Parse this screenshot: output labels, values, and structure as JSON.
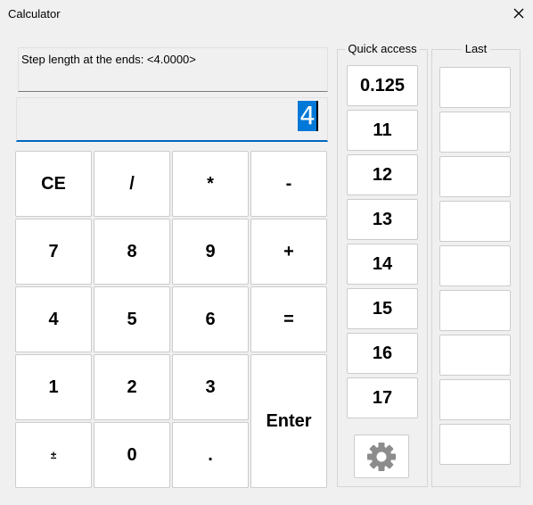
{
  "window": {
    "title": "Calculator"
  },
  "prompt": "Step length at the ends:  <4.0000>",
  "entry": {
    "value": "4"
  },
  "keypad": {
    "ce": "CE",
    "divide": "/",
    "multiply": "*",
    "minus": "-",
    "seven": "7",
    "eight": "8",
    "nine": "9",
    "plus": "+",
    "four": "4",
    "five": "5",
    "six": "6",
    "equals": "=",
    "one": "1",
    "two": "2",
    "three": "3",
    "enter": "Enter",
    "plus_minus": "±",
    "zero": "0",
    "dot": "."
  },
  "quick_access": {
    "title": "Quick access",
    "items": [
      "0.125",
      "11",
      "12",
      "13",
      "14",
      "15",
      "16",
      "17"
    ]
  },
  "last": {
    "title": "Last",
    "slot_count": 9
  },
  "icons": {
    "close": "close-icon",
    "settings": "gear-icon"
  },
  "colors": {
    "accent": "#0078d7",
    "underline": "#0067c0"
  }
}
